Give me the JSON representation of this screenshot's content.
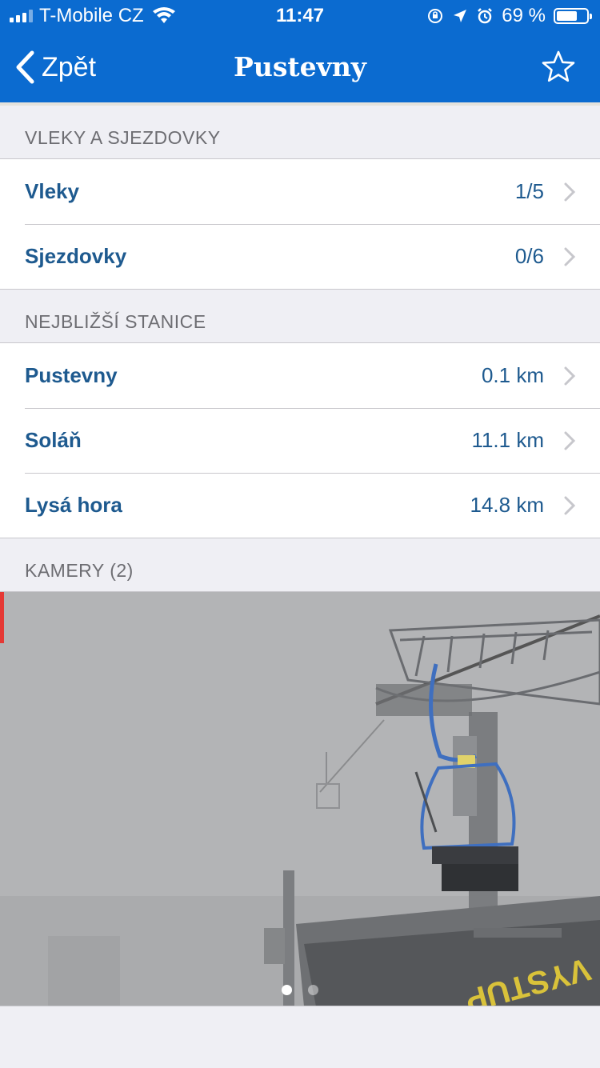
{
  "status_bar": {
    "carrier": "T-Mobile CZ",
    "time": "11:47",
    "battery_text": "69 %",
    "battery_level": 0.69,
    "icons": [
      "wifi-icon",
      "rotation-lock-icon",
      "location-icon",
      "alarm-icon",
      "battery-icon"
    ]
  },
  "nav": {
    "back_label": "Zpět",
    "title": "Pustevny",
    "favorite_icon": "star-outline-icon"
  },
  "sections": [
    {
      "header": "VLEKY A SJEZDOVKY",
      "rows": [
        {
          "label": "Vleky",
          "value": "1/5"
        },
        {
          "label": "Sjezdovky",
          "value": "0/6"
        }
      ]
    },
    {
      "header": "NEJBLIŽŠÍ STANICE",
      "rows": [
        {
          "label": "Pustevny",
          "value": "0.1 km"
        },
        {
          "label": "Soláň",
          "value": "11.1 km"
        },
        {
          "label": "Lysá hora",
          "value": "14.8 km"
        }
      ]
    }
  ],
  "cameras": {
    "header": "KAMERY (2)",
    "page_count": 2,
    "current_page": 1,
    "ground_text": "VYSTUP"
  },
  "colors": {
    "nav_background": "#0b6bd0",
    "row_text": "#1e5a8f",
    "section_header_text": "#6d6d72",
    "background": "#efeff4"
  }
}
